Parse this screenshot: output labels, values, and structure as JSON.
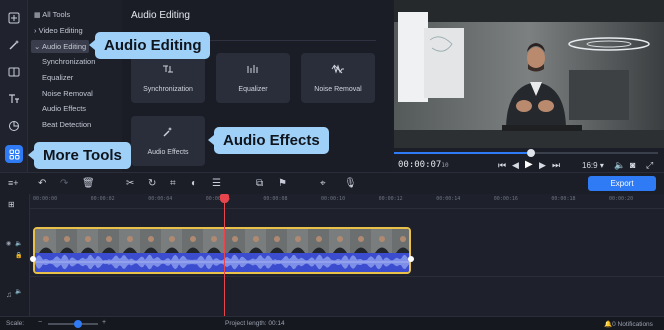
{
  "sidebar": {
    "rail": [
      {
        "icon": "import-icon"
      },
      {
        "icon": "magic-wand-icon"
      },
      {
        "icon": "transitions-icon"
      },
      {
        "icon": "titles-icon"
      },
      {
        "icon": "stickers-icon"
      },
      {
        "icon": "more-tools-icon"
      }
    ],
    "tree": {
      "all_tools": "All Tools",
      "video_editing": "Video Editing",
      "audio_editing": "Audio Editing",
      "items": [
        "Synchronization",
        "Equalizer",
        "Noise Removal",
        "Audio Effects",
        "Beat Detection"
      ]
    }
  },
  "pane": {
    "title": "Audio Editing",
    "tiles": [
      {
        "label": "Synchronization",
        "icon": "sync-icon"
      },
      {
        "label": "Equalizer",
        "icon": "equalizer-icon"
      },
      {
        "label": "Noise Removal",
        "icon": "noise-removal-icon"
      },
      {
        "label": "Audio Effects",
        "icon": "audio-effects-icon"
      }
    ]
  },
  "tooltips": {
    "audio_editing": "Audio Editing",
    "audio_effects": "Audio Effects",
    "more_tools": "More Tools"
  },
  "player": {
    "time": "00:00:07",
    "time_ms": "10",
    "aspect": "16:9",
    "progress": 0.52
  },
  "toolbar": {
    "export_label": "Export"
  },
  "timeline": {
    "ticks": [
      "00:00:00",
      "00:00:02",
      "00:00:04",
      "00:00:06",
      "00:00:08",
      "00:00:10",
      "00:00:12",
      "00:00:14",
      "00:00:16",
      "00:00:18",
      "00:00:20",
      "00:00:22"
    ]
  },
  "status": {
    "scale_label": "Scale:",
    "project_length_label": "Project length:",
    "project_length": "00:14",
    "notifications": "0 Notifications"
  },
  "colors": {
    "accent": "#2f7bf5",
    "tooltip": "#9fd0f7",
    "clip_border": "#e8c04a",
    "waveform": "#5b6fd8",
    "playhead": "#e8454d"
  }
}
